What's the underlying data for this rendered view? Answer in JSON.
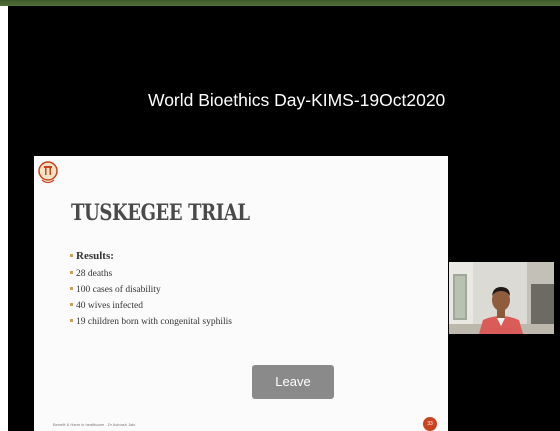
{
  "meeting": {
    "title": "World Bioethics Day-KIMS-19Oct2020"
  },
  "slide": {
    "title": "TUSKEGEE TRIAL",
    "results_heading": "Results:",
    "bullets": [
      "28 deaths",
      "100 cases of disability",
      "40 wives infected",
      "19 children born with congenital syphilis"
    ],
    "footer": "Benefit & Harm in healthcare - Dr Avinash Jain",
    "page_number": "33",
    "logo_icon": "college-emblem-icon",
    "accent_color": "#c9431e"
  },
  "controls": {
    "leave_label": "Leave"
  },
  "participant": {
    "icon": "participant-video-icon"
  }
}
